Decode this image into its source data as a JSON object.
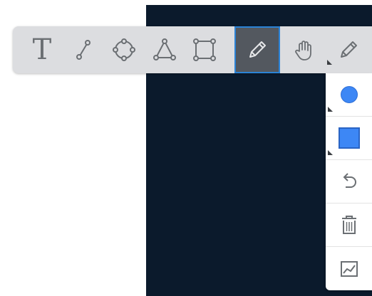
{
  "toolbar": {
    "tools": [
      {
        "name": "text",
        "glyph": "T",
        "icon": "text-icon"
      },
      {
        "name": "line",
        "icon": "line-icon"
      },
      {
        "name": "circle",
        "icon": "circle-icon"
      },
      {
        "name": "triangle",
        "icon": "triangle-icon"
      },
      {
        "name": "rectangle",
        "icon": "rectangle-icon"
      },
      {
        "name": "pencil",
        "icon": "pencil-icon",
        "active": true
      },
      {
        "name": "pan",
        "icon": "hand-icon"
      },
      {
        "name": "pen-menu",
        "icon": "pencil-icon",
        "has_submenu": true
      }
    ]
  },
  "side_panel": {
    "items": [
      {
        "name": "stroke-color",
        "icon": "circle-swatch-icon",
        "color": "#3d87f5",
        "has_submenu": true
      },
      {
        "name": "fill-color",
        "icon": "square-swatch-icon",
        "color": "#3d87f5",
        "has_submenu": true
      },
      {
        "name": "undo",
        "icon": "undo-icon"
      },
      {
        "name": "delete",
        "icon": "trash-icon"
      },
      {
        "name": "chart",
        "icon": "line-chart-icon"
      }
    ]
  },
  "colors": {
    "canvas_background": "#0b1a2c",
    "toolbar_background": "#dcdde0",
    "active_tool_background": "#53585f",
    "active_tool_border": "#2b83d6",
    "icon_color": "#6b6f73",
    "accent_blue": "#3d87f5"
  }
}
